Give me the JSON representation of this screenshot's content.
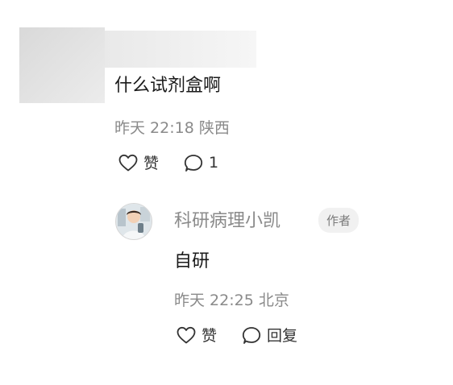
{
  "comment": {
    "text": "什么试剂盒啊",
    "meta": "昨天 22:18 陕西",
    "like_label": "赞",
    "reply_count": "1"
  },
  "reply": {
    "author": "科研病理小凯",
    "author_badge": "作者",
    "text": "自研",
    "meta": "昨天 22:25 北京",
    "like_label": "赞",
    "reply_label": "回复"
  },
  "icons": {
    "like": "heart-outline-icon",
    "comment": "speech-bubble-icon"
  },
  "colors": {
    "text_primary": "#1a1a1a",
    "text_secondary": "#8a8a8a",
    "badge_bg": "#f1f1f1"
  }
}
